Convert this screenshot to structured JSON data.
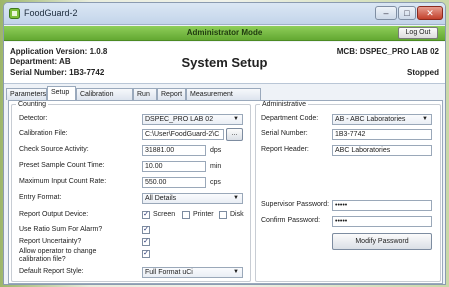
{
  "window": {
    "title": "FoodGuard-2",
    "minimize": "–",
    "maximize": "□",
    "close": "✕"
  },
  "mode_bar": {
    "title": "Administrator Mode",
    "logout_label": "Log Out"
  },
  "info": {
    "app_version": "Application Version: 1.0.8",
    "department": "Department: AB",
    "serial": "Serial Number: 1B3-7742",
    "page_title": "System Setup",
    "mcb": "MCB: DSPEC_PRO LAB 02",
    "status": "Stopped"
  },
  "tabs": [
    "Parameters",
    "Setup",
    "Calibration Check",
    "Run",
    "Report",
    "Measurement Statistics"
  ],
  "active_tab": "Setup",
  "counting": {
    "legend": "Counting",
    "detector_label": "Detector:",
    "detector_value": "DSPEC_PRO LAB 02",
    "calibration_file_label": "Calibration File:",
    "calibration_file_value": "C:\\User\\FoodGuard-2\\C",
    "browse_label": "...",
    "check_source_label": "Check Source Activity:",
    "check_source_value": "31881.00",
    "check_source_unit": "dps",
    "preset_label": "Preset Sample Count Time:",
    "preset_value": "10.00",
    "preset_unit": "min",
    "max_rate_label": "Maximum Input Count Rate:",
    "max_rate_value": "550.00",
    "max_rate_unit": "cps",
    "entry_format_label": "Entry Format:",
    "entry_format_value": "All Details",
    "report_device_label": "Report Output Device:",
    "screen_label": "Screen",
    "screen_checked": true,
    "printer_label": "Printer",
    "printer_checked": false,
    "disk_label": "Disk",
    "disk_checked": false,
    "ratio_label": "Use Ratio Sum For Alarm?",
    "ratio_checked": true,
    "uncertainty_label": "Report Uncertainty?",
    "uncertainty_checked": true,
    "allow_label_1": "Allow operator to change",
    "allow_label_2": "calibration file?",
    "allow_checked": true,
    "report_style_label": "Default Report Style:",
    "report_style_value": "Full Format uCi"
  },
  "administrative": {
    "legend": "Administrative",
    "dept_code_label": "Department Code:",
    "dept_code_value": "AB - ABC Laboratories",
    "serial_label": "Serial Number:",
    "serial_value": "1B3-7742",
    "report_header_label": "Report Header:",
    "report_header_value": "ABC Laboratories",
    "supervisor_pw_label": "Supervisor Password:",
    "supervisor_pw_value": "•••••",
    "confirm_pw_label": "Confirm Password:",
    "confirm_pw_value": "•••••",
    "modify_pw_label": "Modify Password"
  },
  "colors": {
    "mode_bar": "#6fb63a",
    "title_bar": "#c9d9ee",
    "panel": "#ffffff"
  },
  "check_glyph": "✓",
  "dropdown_glyph": "▼"
}
